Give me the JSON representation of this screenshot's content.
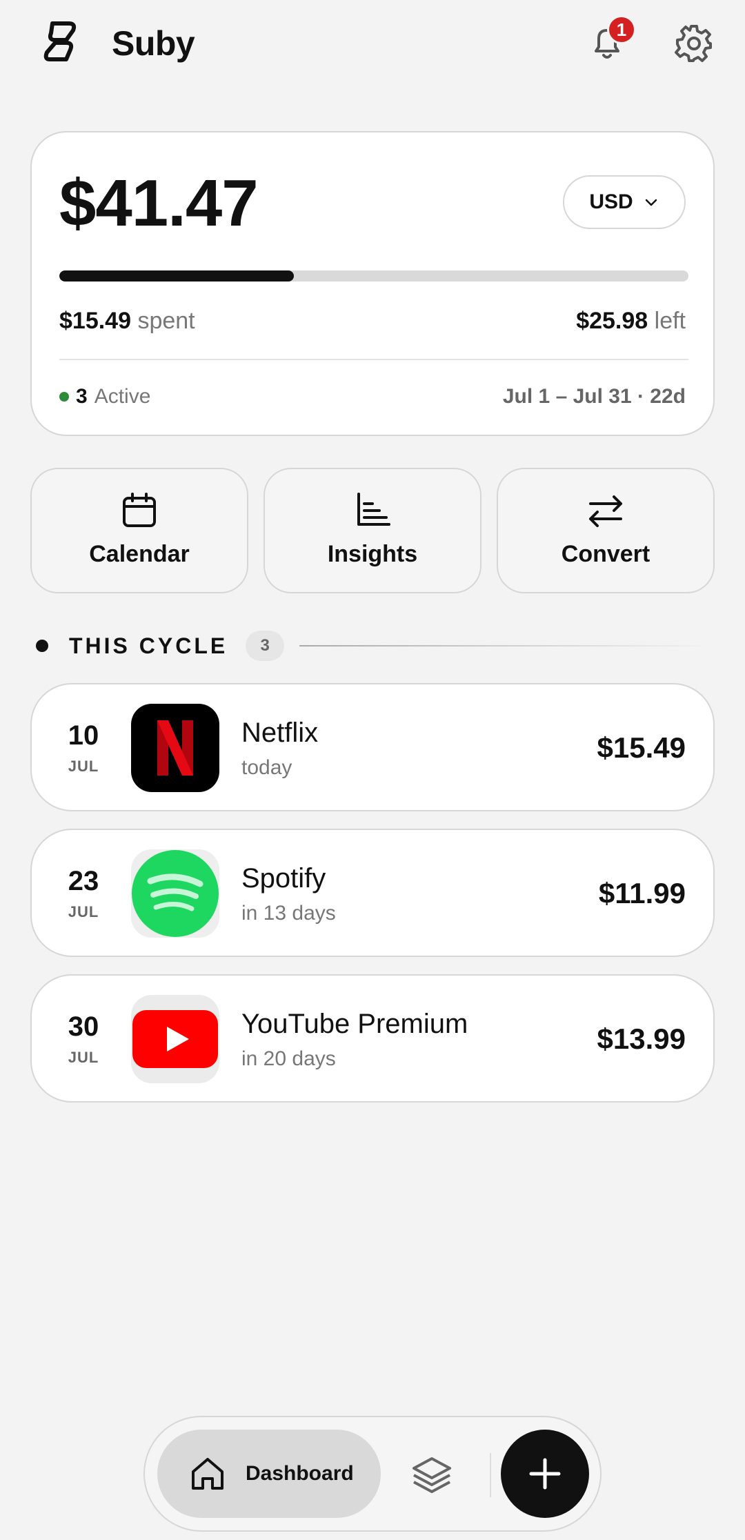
{
  "header": {
    "app_name": "Suby",
    "notification_count": "1"
  },
  "summary": {
    "total": "$41.47",
    "currency": "USD",
    "progress_fraction": 0.373,
    "spent_amount": "$15.49",
    "spent_label": "spent",
    "left_amount": "$25.98",
    "left_label": "left",
    "active_count": "3",
    "active_label": "Active",
    "date_range": "Jul 1 – Jul 31 · 22d"
  },
  "actions": [
    {
      "label": "Calendar",
      "icon": "calendar-icon"
    },
    {
      "label": "Insights",
      "icon": "bar-chart-icon"
    },
    {
      "label": "Convert",
      "icon": "swap-arrows-icon"
    }
  ],
  "section": {
    "title": "THIS CYCLE",
    "count": "3"
  },
  "subscriptions": [
    {
      "day": "10",
      "month": "JUL",
      "name": "Netflix",
      "due": "today",
      "price": "$15.49",
      "icon": "netflix-icon"
    },
    {
      "day": "23",
      "month": "JUL",
      "name": "Spotify",
      "due": "in 13 days",
      "price": "$11.99",
      "icon": "spotify-icon"
    },
    {
      "day": "30",
      "month": "JUL",
      "name": "YouTube Premium",
      "due": "in 20 days",
      "price": "$13.99",
      "icon": "youtube-icon"
    }
  ],
  "nav": {
    "dashboard_label": "Dashboard"
  },
  "colors": {
    "accent": "#111111",
    "badge": "#d42020",
    "active_dot": "#2f8a3a",
    "spotify": "#1ed760",
    "youtube": "#ff0000",
    "netflix": "#e50914"
  }
}
